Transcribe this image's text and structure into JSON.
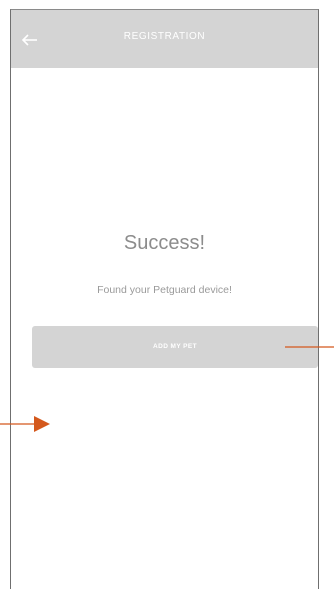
{
  "header": {
    "title": "REGISTRATION",
    "back_icon": "back-arrow-icon"
  },
  "main": {
    "success_title": "Success!",
    "success_message": "Found your Petguard device!",
    "add_pet_label": "ADD MY PET"
  },
  "colors": {
    "header_bg": "#d4d4d4",
    "button_bg": "#d4d4d4",
    "title_text": "#8c8c8c",
    "message_text": "#9a9a9a",
    "annotation_arrow": "#d4581c"
  }
}
